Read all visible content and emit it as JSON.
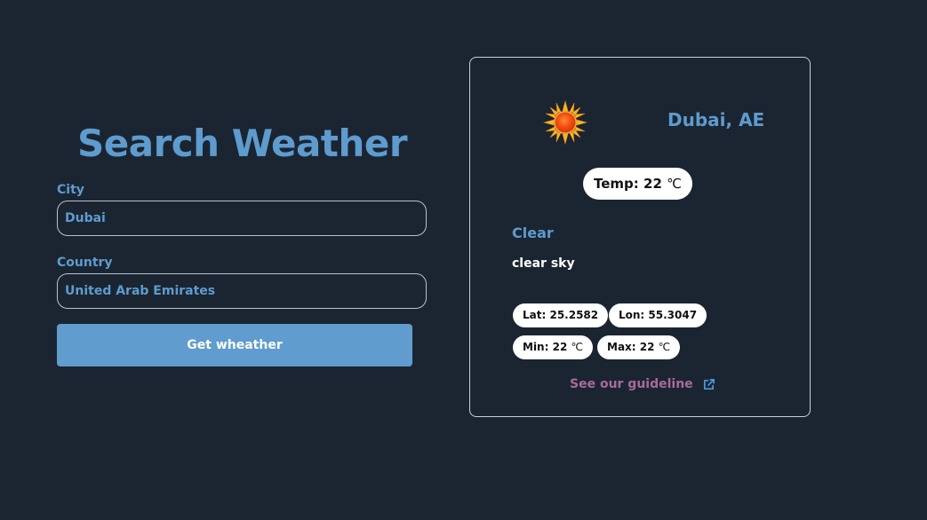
{
  "search": {
    "title": "Search Weather",
    "city_label": "City",
    "city_value": "Dubai",
    "country_label": "Country",
    "country_value": "United Arab Emirates",
    "submit_label": "Get wheather"
  },
  "weather": {
    "location": "Dubai, AE",
    "icon": "sun-icon",
    "temp_label": "Temp:",
    "temp_value": "22",
    "unit": "℃",
    "condition": "Clear",
    "description": "clear sky",
    "lat_label": "Lat:",
    "lat_value": "25.2582",
    "lon_label": "Lon:",
    "lon_value": "55.3047",
    "min_label": "Min:",
    "min_value": "22",
    "max_label": "Max:",
    "max_value": "22",
    "guideline_text": "See our guideline"
  },
  "colors": {
    "background": "#1b2531",
    "accent": "#5e9bce",
    "button": "#609ccd",
    "link": "#a86b9b"
  }
}
